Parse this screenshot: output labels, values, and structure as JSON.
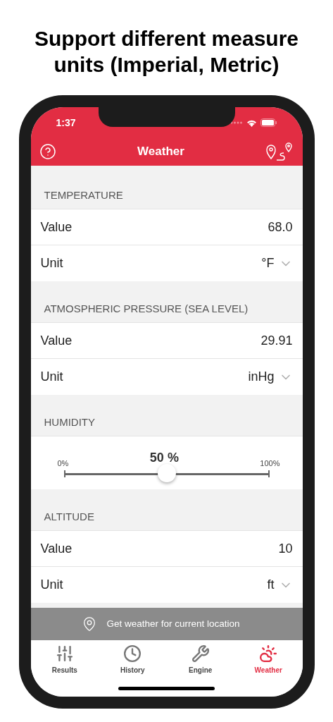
{
  "headline": "Support different measure units (Imperial, Metric)",
  "status_bar": {
    "time": "1:37"
  },
  "nav": {
    "title": "Weather"
  },
  "sections": [
    {
      "title": "TEMPERATURE",
      "rows": [
        {
          "kind": "value",
          "label": "Value",
          "value": "68.0"
        },
        {
          "kind": "unit",
          "label": "Unit",
          "value": "°F"
        }
      ]
    },
    {
      "title": "ATMOSPHERIC PRESSURE (SEA LEVEL)",
      "rows": [
        {
          "kind": "value",
          "label": "Value",
          "value": "29.91"
        },
        {
          "kind": "unit",
          "label": "Unit",
          "value": "inHg"
        }
      ]
    },
    {
      "title": "HUMIDITY",
      "rows": [
        {
          "kind": "slider",
          "reading": "50 %",
          "min_label": "0%",
          "max_label": "100%",
          "level": 0.5
        }
      ]
    },
    {
      "title": "ALTITUDE",
      "rows": [
        {
          "kind": "value",
          "label": "Value",
          "value": "10"
        },
        {
          "kind": "unit",
          "label": "Unit",
          "value": "ft"
        }
      ]
    }
  ],
  "banner": {
    "label": "Get weather for current location"
  },
  "tabs": [
    {
      "kind": "sliders",
      "label": "Results",
      "selected": false
    },
    {
      "kind": "clock",
      "label": "History",
      "selected": false
    },
    {
      "kind": "tools",
      "label": "Engine",
      "selected": false
    },
    {
      "kind": "weather",
      "label": "Weather",
      "selected": true
    }
  ]
}
